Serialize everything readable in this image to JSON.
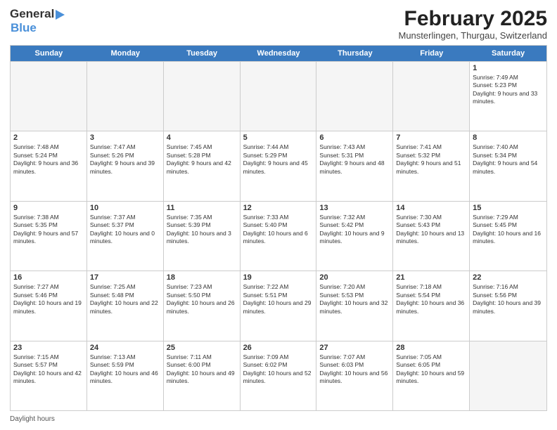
{
  "header": {
    "logo_general": "General",
    "logo_blue": "Blue",
    "month_title": "February 2025",
    "location": "Munsterlingen, Thurgau, Switzerland"
  },
  "days_of_week": [
    "Sunday",
    "Monday",
    "Tuesday",
    "Wednesday",
    "Thursday",
    "Friday",
    "Saturday"
  ],
  "weeks": [
    [
      {
        "day": "",
        "info": ""
      },
      {
        "day": "",
        "info": ""
      },
      {
        "day": "",
        "info": ""
      },
      {
        "day": "",
        "info": ""
      },
      {
        "day": "",
        "info": ""
      },
      {
        "day": "",
        "info": ""
      },
      {
        "day": "1",
        "info": "Sunrise: 7:49 AM\nSunset: 5:23 PM\nDaylight: 9 hours and 33 minutes."
      }
    ],
    [
      {
        "day": "2",
        "info": "Sunrise: 7:48 AM\nSunset: 5:24 PM\nDaylight: 9 hours and 36 minutes."
      },
      {
        "day": "3",
        "info": "Sunrise: 7:47 AM\nSunset: 5:26 PM\nDaylight: 9 hours and 39 minutes."
      },
      {
        "day": "4",
        "info": "Sunrise: 7:45 AM\nSunset: 5:28 PM\nDaylight: 9 hours and 42 minutes."
      },
      {
        "day": "5",
        "info": "Sunrise: 7:44 AM\nSunset: 5:29 PM\nDaylight: 9 hours and 45 minutes."
      },
      {
        "day": "6",
        "info": "Sunrise: 7:43 AM\nSunset: 5:31 PM\nDaylight: 9 hours and 48 minutes."
      },
      {
        "day": "7",
        "info": "Sunrise: 7:41 AM\nSunset: 5:32 PM\nDaylight: 9 hours and 51 minutes."
      },
      {
        "day": "8",
        "info": "Sunrise: 7:40 AM\nSunset: 5:34 PM\nDaylight: 9 hours and 54 minutes."
      }
    ],
    [
      {
        "day": "9",
        "info": "Sunrise: 7:38 AM\nSunset: 5:35 PM\nDaylight: 9 hours and 57 minutes."
      },
      {
        "day": "10",
        "info": "Sunrise: 7:37 AM\nSunset: 5:37 PM\nDaylight: 10 hours and 0 minutes."
      },
      {
        "day": "11",
        "info": "Sunrise: 7:35 AM\nSunset: 5:39 PM\nDaylight: 10 hours and 3 minutes."
      },
      {
        "day": "12",
        "info": "Sunrise: 7:33 AM\nSunset: 5:40 PM\nDaylight: 10 hours and 6 minutes."
      },
      {
        "day": "13",
        "info": "Sunrise: 7:32 AM\nSunset: 5:42 PM\nDaylight: 10 hours and 9 minutes."
      },
      {
        "day": "14",
        "info": "Sunrise: 7:30 AM\nSunset: 5:43 PM\nDaylight: 10 hours and 13 minutes."
      },
      {
        "day": "15",
        "info": "Sunrise: 7:29 AM\nSunset: 5:45 PM\nDaylight: 10 hours and 16 minutes."
      }
    ],
    [
      {
        "day": "16",
        "info": "Sunrise: 7:27 AM\nSunset: 5:46 PM\nDaylight: 10 hours and 19 minutes."
      },
      {
        "day": "17",
        "info": "Sunrise: 7:25 AM\nSunset: 5:48 PM\nDaylight: 10 hours and 22 minutes."
      },
      {
        "day": "18",
        "info": "Sunrise: 7:23 AM\nSunset: 5:50 PM\nDaylight: 10 hours and 26 minutes."
      },
      {
        "day": "19",
        "info": "Sunrise: 7:22 AM\nSunset: 5:51 PM\nDaylight: 10 hours and 29 minutes."
      },
      {
        "day": "20",
        "info": "Sunrise: 7:20 AM\nSunset: 5:53 PM\nDaylight: 10 hours and 32 minutes."
      },
      {
        "day": "21",
        "info": "Sunrise: 7:18 AM\nSunset: 5:54 PM\nDaylight: 10 hours and 36 minutes."
      },
      {
        "day": "22",
        "info": "Sunrise: 7:16 AM\nSunset: 5:56 PM\nDaylight: 10 hours and 39 minutes."
      }
    ],
    [
      {
        "day": "23",
        "info": "Sunrise: 7:15 AM\nSunset: 5:57 PM\nDaylight: 10 hours and 42 minutes."
      },
      {
        "day": "24",
        "info": "Sunrise: 7:13 AM\nSunset: 5:59 PM\nDaylight: 10 hours and 46 minutes."
      },
      {
        "day": "25",
        "info": "Sunrise: 7:11 AM\nSunset: 6:00 PM\nDaylight: 10 hours and 49 minutes."
      },
      {
        "day": "26",
        "info": "Sunrise: 7:09 AM\nSunset: 6:02 PM\nDaylight: 10 hours and 52 minutes."
      },
      {
        "day": "27",
        "info": "Sunrise: 7:07 AM\nSunset: 6:03 PM\nDaylight: 10 hours and 56 minutes."
      },
      {
        "day": "28",
        "info": "Sunrise: 7:05 AM\nSunset: 6:05 PM\nDaylight: 10 hours and 59 minutes."
      },
      {
        "day": "",
        "info": ""
      }
    ]
  ],
  "footer": {
    "daylight_label": "Daylight hours"
  }
}
